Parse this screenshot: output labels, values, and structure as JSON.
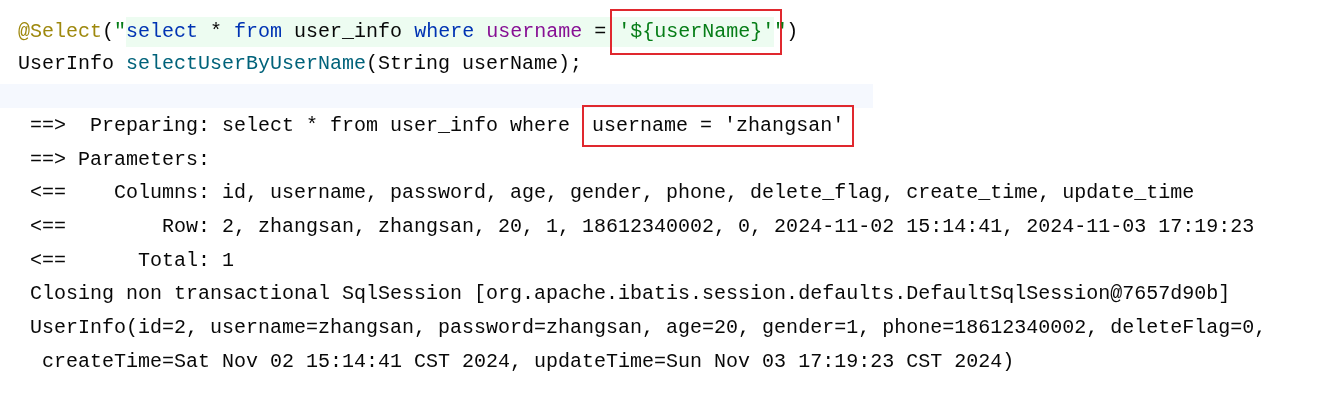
{
  "editor": {
    "lines": [
      {
        "tokens": [
          {
            "text": "@Select",
            "kind": "annotation",
            "injected": false,
            "boxed": false
          },
          {
            "text": "(",
            "kind": "plain",
            "injected": false,
            "boxed": false
          },
          {
            "text": "\"",
            "kind": "string",
            "injected": false,
            "boxed": false
          },
          {
            "text": "select",
            "kind": "keyword",
            "injected": true,
            "boxed": false
          },
          {
            "text": " * ",
            "kind": "plain",
            "injected": true,
            "boxed": false
          },
          {
            "text": "from",
            "kind": "keyword",
            "injected": true,
            "boxed": false
          },
          {
            "text": " user_info ",
            "kind": "plain",
            "injected": true,
            "boxed": false
          },
          {
            "text": "where",
            "kind": "keyword",
            "injected": true,
            "boxed": false
          },
          {
            "text": " username",
            "kind": "column",
            "injected": true,
            "boxed": false
          },
          {
            "text": " = ",
            "kind": "plain",
            "injected": true,
            "boxed": false
          },
          {
            "text": "'${userName}'",
            "kind": "string",
            "injected": true,
            "boxed": true
          },
          {
            "text": "\"",
            "kind": "string",
            "injected": false,
            "boxed": false
          },
          {
            "text": ")",
            "kind": "plain",
            "injected": false,
            "boxed": false
          }
        ]
      },
      {
        "tokens": [
          {
            "text": "UserInfo ",
            "kind": "plain",
            "injected": false,
            "boxed": false
          },
          {
            "text": "selectUserByUserName",
            "kind": "method",
            "injected": false,
            "boxed": false
          },
          {
            "text": "(String userName);",
            "kind": "plain",
            "injected": false,
            "boxed": false
          }
        ]
      }
    ],
    "current_line_highlighted": true
  },
  "console": {
    "lines": [
      {
        "segments": [
          {
            "text": "==>  Preparing: select * from user_info where ",
            "boxed": false
          },
          {
            "text": "username = 'zhangsan'",
            "boxed": true
          }
        ]
      },
      {
        "segments": [
          {
            "text": "==> Parameters:",
            "boxed": false
          }
        ]
      },
      {
        "segments": [
          {
            "text": "<==    Columns: id, username, password, age, gender, phone, delete_flag, create_time, update_time",
            "boxed": false
          }
        ]
      },
      {
        "segments": [
          {
            "text": "<==        Row: 2, zhangsan, zhangsan, 20, 1, 18612340002, 0, 2024-11-02 15:14:41, 2024-11-03 17:19:23",
            "boxed": false
          }
        ]
      },
      {
        "segments": [
          {
            "text": "<==      Total: 1",
            "boxed": false
          }
        ]
      },
      {
        "segments": [
          {
            "text": "Closing non transactional SqlSession [org.apache.ibatis.session.defaults.DefaultSqlSession@7657d90b]",
            "boxed": false
          }
        ]
      },
      {
        "segments": [
          {
            "text": "UserInfo(id=2, username=zhangsan, password=zhangsan, age=20, gender=1, phone=18612340002, deleteFlag=0,",
            "boxed": false
          }
        ]
      },
      {
        "segments": [
          {
            "text": " createTime=Sat Nov 02 15:14:41 CST 2024, updateTime=Sun Nov 03 17:19:23 CST 2024)",
            "boxed": false
          }
        ]
      }
    ]
  }
}
